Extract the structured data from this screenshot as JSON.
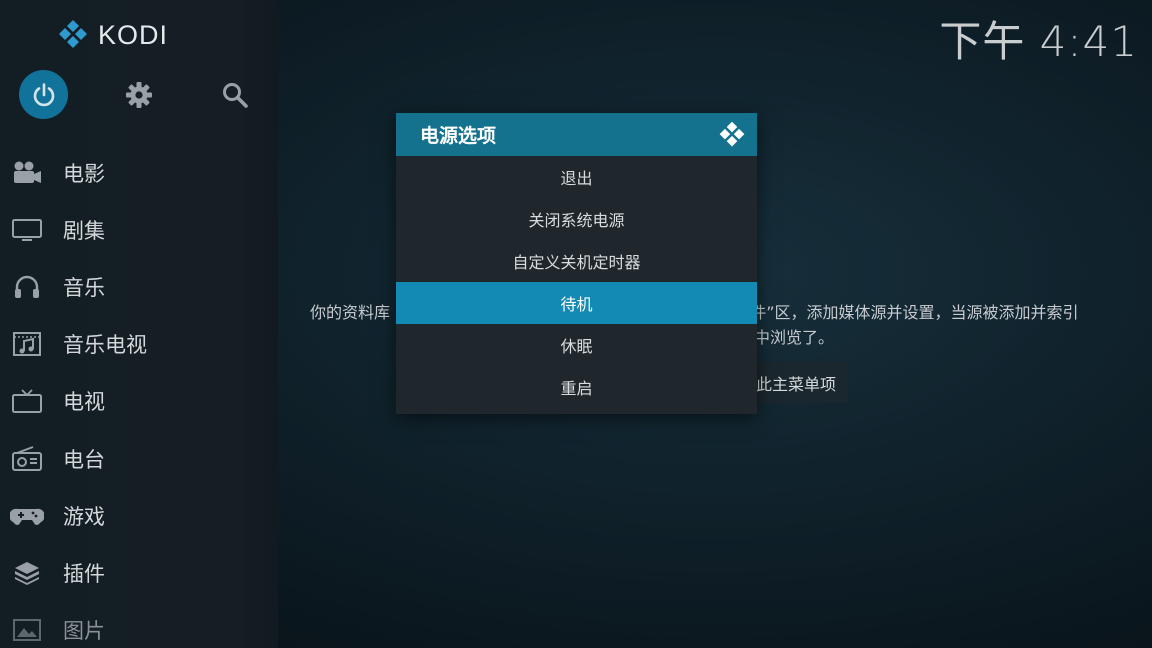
{
  "app": {
    "name": "KODI"
  },
  "clock": "下午 4:41",
  "top_buttons": {
    "power_icon": "power-icon",
    "settings_icon": "gear-icon",
    "search_icon": "search-icon"
  },
  "sidebar": {
    "items": [
      {
        "label": "电影",
        "icon": "movie-camera-icon"
      },
      {
        "label": "剧集",
        "icon": "monitor-icon"
      },
      {
        "label": "音乐",
        "icon": "headphones-icon"
      },
      {
        "label": "音乐电视",
        "icon": "music-video-icon"
      },
      {
        "label": "电视",
        "icon": "tv-icon"
      },
      {
        "label": "电台",
        "icon": "radio-icon"
      },
      {
        "label": "游戏",
        "icon": "gamepad-icon"
      },
      {
        "label": "插件",
        "icon": "addons-box-icon"
      },
      {
        "label": "图片",
        "icon": "picture-icon"
      }
    ]
  },
  "background": {
    "info_text_left": "你的资料库",
    "info_text_right": "件”区，添加媒体源并设置，当源被添加并索引",
    "info_line2": "中浏览了。",
    "remove_button_label": "此主菜单项"
  },
  "dialog": {
    "title": "电源选项",
    "options": [
      "退出",
      "关闭系统电源",
      "自定义关机定时器",
      "待机",
      "休眠",
      "重启"
    ],
    "selected_index": 3
  },
  "colors": {
    "accent": "#12739a",
    "dialog_header": "#15728f",
    "selected_option": "#128ab3",
    "sidebar": "#141e24"
  }
}
